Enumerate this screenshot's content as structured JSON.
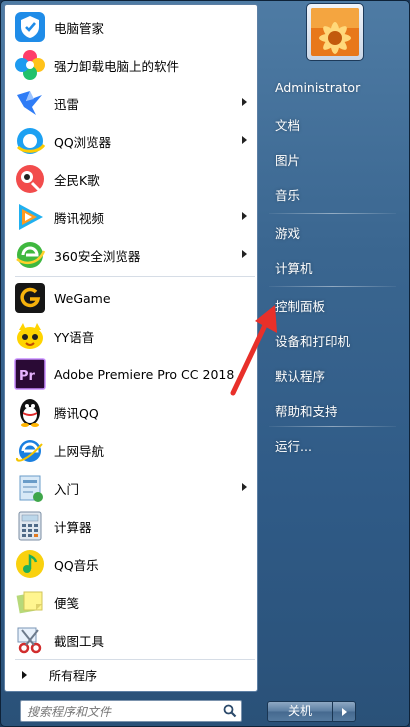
{
  "programs": [
    {
      "label": "电脑管家",
      "has_submenu": false,
      "icon": "tencent-pc-manager-icon"
    },
    {
      "label": "强力卸载电脑上的软件",
      "has_submenu": false,
      "icon": "uninstaller-flower-icon"
    },
    {
      "label": "迅雷",
      "has_submenu": true,
      "icon": "xunlei-bird-icon"
    },
    {
      "label": "QQ浏览器",
      "has_submenu": true,
      "icon": "qq-browser-icon"
    },
    {
      "label": "全民K歌",
      "has_submenu": false,
      "icon": "kge-icon"
    },
    {
      "label": "腾讯视频",
      "has_submenu": true,
      "icon": "tencent-video-icon"
    },
    {
      "label": "360安全浏览器",
      "has_submenu": true,
      "icon": "360-browser-icon"
    },
    {
      "label": "WeGame",
      "has_submenu": false,
      "icon": "wegame-icon"
    },
    {
      "label": "YY语音",
      "has_submenu": false,
      "icon": "yy-voice-icon"
    },
    {
      "label": "Adobe Premiere Pro CC 2018",
      "has_submenu": false,
      "icon": "premiere-pro-icon"
    },
    {
      "label": "腾讯QQ",
      "has_submenu": false,
      "icon": "qq-penguin-icon"
    },
    {
      "label": "上网导航",
      "has_submenu": false,
      "icon": "ie-navigation-icon"
    },
    {
      "label": "入门",
      "has_submenu": true,
      "icon": "getting-started-icon"
    },
    {
      "label": "计算器",
      "has_submenu": false,
      "icon": "calculator-icon"
    },
    {
      "label": "QQ音乐",
      "has_submenu": false,
      "icon": "qq-music-icon"
    },
    {
      "label": "便笺",
      "has_submenu": false,
      "icon": "sticky-notes-icon"
    },
    {
      "label": "截图工具",
      "has_submenu": false,
      "icon": "snipping-tool-icon"
    }
  ],
  "all_programs_label": "所有程序",
  "search": {
    "placeholder": "搜索程序和文件"
  },
  "user": {
    "name": "Administrator"
  },
  "right_links": [
    "文档",
    "图片",
    "音乐",
    "游戏",
    "计算机",
    "控制面板",
    "设备和打印机",
    "默认程序",
    "帮助和支持",
    "运行..."
  ],
  "shutdown_label": "关机",
  "colors": {
    "frame": "#3a6690",
    "pane": "#ffffff",
    "pointer": "#e8302a"
  }
}
